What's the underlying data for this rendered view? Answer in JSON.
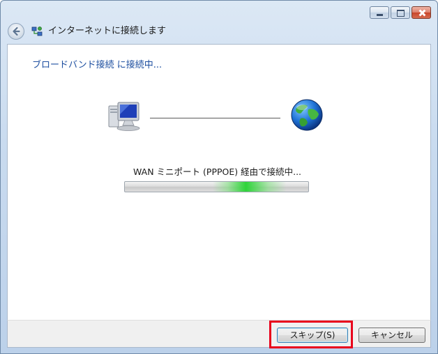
{
  "window": {
    "title": "インターネットに接続します"
  },
  "main": {
    "heading": "ブロードバンド接続 に接続中...",
    "status": "WAN ミニポート (PPPOE) 経由で接続中...",
    "progress_state": "indeterminate"
  },
  "footer": {
    "skip_label": "スキップ(S)",
    "cancel_label": "キャンセル"
  },
  "icons": {
    "back": "back-arrow-icon",
    "app": "network-connection-icon",
    "computer": "computer-icon",
    "internet": "globe-icon"
  },
  "colors": {
    "heading": "#1e4fa0",
    "highlight": "#e8001c",
    "progress": "#2fd43a"
  }
}
